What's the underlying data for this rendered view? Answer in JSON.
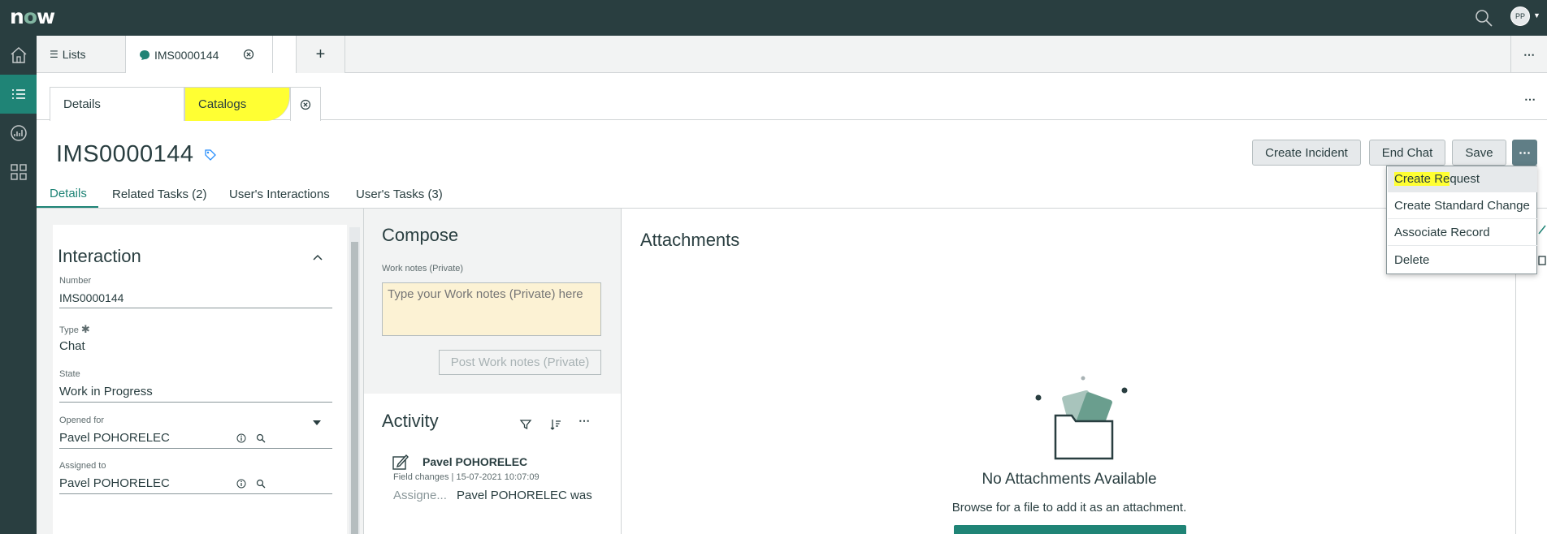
{
  "app": {
    "logo_text": "now",
    "user_initials": "PP"
  },
  "colors": {
    "header_bg": "#293e40",
    "accent": "#1f8476",
    "highlight": "#ffff33",
    "worknote_bg": "#fcf2d4"
  },
  "nav": {
    "items": [
      "home-icon",
      "list-icon",
      "analytics-icon",
      "grid-icon"
    ],
    "selected": "list-icon"
  },
  "workspace_tabs": {
    "lists": "Lists",
    "record": "IMS0000144",
    "new_tab": "+",
    "more": "⋯"
  },
  "sub_tabs": {
    "details": "Details",
    "catalogs": "Catalogs",
    "more": "⋯"
  },
  "record": {
    "number": "IMS0000144"
  },
  "actions": {
    "create_incident": "Create Incident",
    "end_chat": "End Chat",
    "save": "Save",
    "more": "⋯"
  },
  "form_tabs": [
    "Details",
    "Related Tasks (2)",
    "User's Interactions",
    "User's Tasks (3)"
  ],
  "interaction": {
    "title": "Interaction",
    "fields": {
      "number": {
        "label": "Number",
        "value": "IMS0000144"
      },
      "type": {
        "label": "Type",
        "required": "✱",
        "value": "Chat"
      },
      "state": {
        "label": "State",
        "value": "Work in Progress"
      },
      "opened_for": {
        "label": "Opened for",
        "value": "Pavel POHORELEC"
      },
      "assigned_to": {
        "label": "Assigned to",
        "value": "Pavel POHORELEC"
      }
    }
  },
  "compose": {
    "title": "Compose",
    "work_notes_label": "Work notes (Private)",
    "work_notes_placeholder": "Type your Work notes (Private) here",
    "post_button": "Post Work notes (Private)"
  },
  "activity": {
    "title": "Activity",
    "entry": {
      "author": "Pavel POHORELEC",
      "meta": "Field changes | 15-07-2021 10:07:09",
      "field": "Assigne...",
      "value": "Pavel POHORELEC was"
    }
  },
  "attachments": {
    "title": "Attachments",
    "empty_title": "No Attachments Available",
    "empty_hint": "Browse for a file to add it as an attachment."
  },
  "dropdown_menu": {
    "items": [
      {
        "label_hl": "Create Re",
        "label_rest": "quest"
      },
      {
        "label": "Create Standard Change"
      },
      {
        "label": "Associate Record"
      },
      {
        "label": "Delete"
      }
    ]
  }
}
